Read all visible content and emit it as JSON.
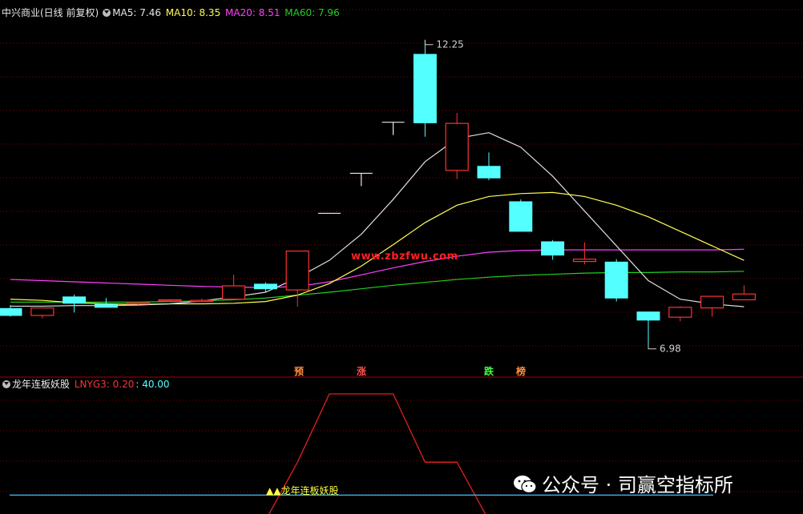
{
  "header": {
    "title": "中兴商业(日线 前复权)",
    "ma5": "MA5: 7.46",
    "ma10": "MA10: 8.35",
    "ma20": "MA20: 8.51",
    "ma60": "MA60: 7.96"
  },
  "indicator_header": {
    "name": "龙年连板妖股",
    "lnyg3": "LNYG3: 0.20",
    "value": ": 40.00"
  },
  "annotations": {
    "high": "12.25",
    "low": "6.98",
    "site": "www.zbzfwu.com",
    "signal_yu": "预",
    "signal_zhang": "涨",
    "signal_die": "跌",
    "signal_bang": "榜",
    "dragon_label": "▲▲龙年连板妖股"
  },
  "watermark": "公众号 · 司赢空指标所",
  "colors": {
    "up": "#ff3232",
    "down": "#54ffff",
    "ma5": "#e0e0e0",
    "ma10": "#ffff50",
    "ma20": "#ff40ff",
    "ma60": "#20d020",
    "grid": "#8b0000",
    "indicator": "#e02020",
    "baseline": "#40c0ff"
  },
  "chart_data": {
    "type": "candlestick",
    "ylim": [
      6.7,
      12.55
    ],
    "candles": [
      {
        "o": 7.62,
        "h": 7.68,
        "l": 7.48,
        "c": 7.5
      },
      {
        "o": 7.5,
        "h": 7.62,
        "l": 7.45,
        "c": 7.63
      },
      {
        "o": 7.82,
        "h": 7.86,
        "l": 7.55,
        "c": 7.71
      },
      {
        "o": 7.69,
        "h": 7.8,
        "l": 7.66,
        "c": 7.64
      },
      {
        "o": 7.7,
        "h": 7.74,
        "l": 7.68,
        "c": 7.72
      },
      {
        "o": 7.76,
        "h": 7.78,
        "l": 7.74,
        "c": 7.77
      },
      {
        "o": 7.76,
        "h": 7.79,
        "l": 7.75,
        "c": 7.76
      },
      {
        "o": 7.78,
        "h": 8.2,
        "l": 7.76,
        "c": 8.01
      },
      {
        "o": 8.04,
        "h": 8.07,
        "l": 7.9,
        "c": 7.96
      },
      {
        "o": 7.94,
        "h": 8.61,
        "l": 7.65,
        "c": 8.61
      },
      {
        "o": 9.26,
        "h": 9.26,
        "l": 9.26,
        "c": 9.26
      },
      {
        "o": 9.95,
        "h": 9.95,
        "l": 9.95,
        "c": 9.95
      },
      {
        "o": 10.83,
        "h": 10.83,
        "l": 10.83,
        "c": 10.83
      },
      {
        "o": 12.0,
        "h": 12.25,
        "l": 10.58,
        "c": 10.82
      },
      {
        "o": 10.0,
        "h": 10.99,
        "l": 9.85,
        "c": 10.81
      },
      {
        "o": 10.07,
        "h": 10.31,
        "l": 9.83,
        "c": 9.87
      },
      {
        "o": 9.46,
        "h": 9.5,
        "l": 8.95,
        "c": 8.95
      },
      {
        "o": 8.77,
        "h": 8.8,
        "l": 8.46,
        "c": 8.54
      },
      {
        "o": 8.43,
        "h": 8.76,
        "l": 8.38,
        "c": 8.47
      },
      {
        "o": 8.42,
        "h": 8.47,
        "l": 7.74,
        "c": 7.8
      },
      {
        "o": 7.56,
        "h": 7.57,
        "l": 6.98,
        "c": 7.42
      },
      {
        "o": 7.47,
        "h": 7.66,
        "l": 7.4,
        "c": 7.64
      },
      {
        "o": 7.63,
        "h": 7.68,
        "l": 7.48,
        "c": 7.83
      },
      {
        "o": 7.77,
        "h": 8.02,
        "l": 7.76,
        "c": 7.87
      }
    ],
    "ma5": [
      7.66,
      7.66,
      7.67,
      7.67,
      7.68,
      7.7,
      7.75,
      7.82,
      7.9,
      8.15,
      8.45,
      8.9,
      9.5,
      10.15,
      10.55,
      10.65,
      10.4,
      9.9,
      9.3,
      8.7,
      8.1,
      7.78,
      7.7,
      7.65
    ],
    "ma10": [
      7.78,
      7.76,
      7.72,
      7.7,
      7.69,
      7.7,
      7.7,
      7.71,
      7.74,
      7.85,
      8.05,
      8.35,
      8.72,
      9.1,
      9.4,
      9.55,
      9.6,
      9.62,
      9.55,
      9.4,
      9.2,
      8.95,
      8.7,
      8.45
    ],
    "ma20": [
      8.12,
      8.1,
      8.08,
      8.06,
      8.04,
      8.02,
      8.0,
      7.99,
      7.98,
      8.0,
      8.08,
      8.2,
      8.32,
      8.43,
      8.52,
      8.59,
      8.62,
      8.63,
      8.63,
      8.63,
      8.63,
      8.63,
      8.63,
      8.64
    ],
    "ma60": [
      7.73,
      7.73,
      7.73,
      7.73,
      7.73,
      7.74,
      7.75,
      7.77,
      7.8,
      7.85,
      7.9,
      7.96,
      8.02,
      8.07,
      8.12,
      8.16,
      8.19,
      8.21,
      8.23,
      8.24,
      8.24,
      8.25,
      8.25,
      8.26
    ],
    "indicator_ylim": [
      0,
      100
    ],
    "indicator": [
      null,
      null,
      null,
      null,
      null,
      null,
      null,
      null,
      0,
      46,
      100,
      100,
      100,
      46,
      46,
      0,
      null,
      null,
      null,
      null,
      null,
      null,
      null,
      null
    ],
    "indicator_baseline": 20
  }
}
